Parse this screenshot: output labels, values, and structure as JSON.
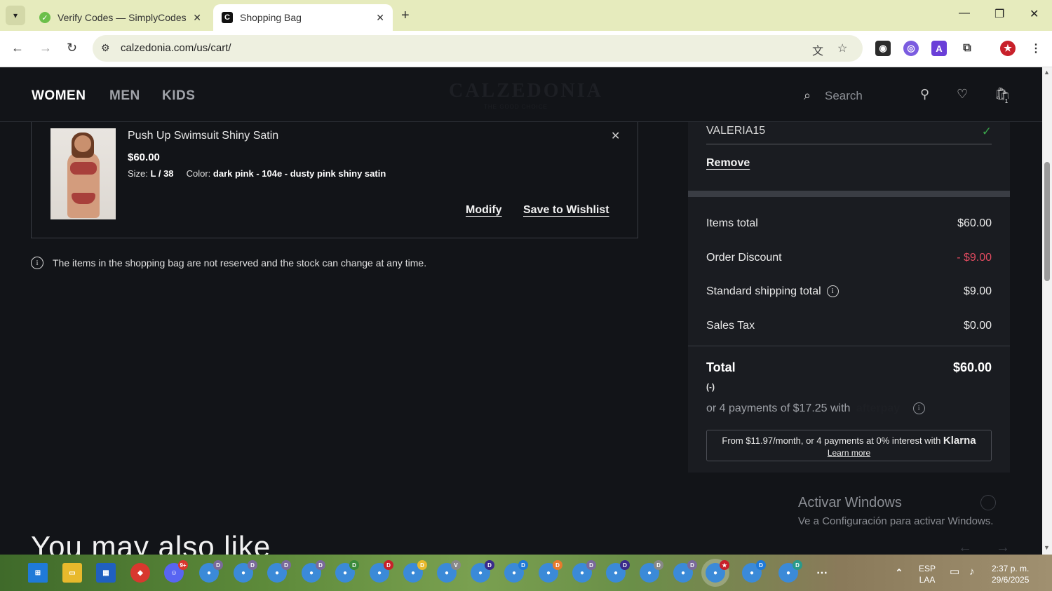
{
  "browser": {
    "tabs": [
      {
        "title": "Verify Codes — SimplyCodes",
        "icon": "simplycodes-icon"
      },
      {
        "title": "Shopping Bag",
        "icon": "calzedonia-icon"
      }
    ],
    "url": "calzedonia.com/us/cart/"
  },
  "header": {
    "nav": [
      "WOMEN",
      "MEN",
      "KIDS"
    ],
    "logo": "CALZEDONIA",
    "logo_sub": "THE GOOD CHOICE",
    "search_placeholder": "Search",
    "bag_count": "1"
  },
  "cart_item": {
    "name": "Push Up Swimsuit Shiny Satin",
    "price": "$60.00",
    "size_label": "Size:",
    "size_value": "L / 38",
    "color_label": "Color:",
    "color_value": "dark pink - 104e - dusty pink shiny satin",
    "modify": "Modify",
    "wishlist": "Save to Wishlist"
  },
  "notice": "The items in the shopping bag are not reserved and the stock can change at any time.",
  "summary": {
    "coupon_code": "VALERIA15",
    "remove": "Remove",
    "rows": [
      {
        "label": "Items total",
        "value": "$60.00"
      },
      {
        "label": "Order Discount",
        "value": "- $9.00"
      },
      {
        "label": "Standard shipping total",
        "value": "$9.00"
      },
      {
        "label": "Sales Tax",
        "value": "$0.00"
      }
    ],
    "total_label": "Total",
    "total_value": "$60.00",
    "total_sub": "(-)",
    "afterpay_text": "or 4 payments of $17.25 with",
    "afterpay_brand": "afterpay",
    "klarna_text": "From $11.97/month, or 4 payments at 0% interest with",
    "klarna_brand": "Klarna",
    "klarna_link": "Learn more"
  },
  "recommend_title": "You may also like",
  "windows_watermark": {
    "title": "Activar Windows",
    "subtitle": "Ve a Configuración para activar Windows."
  },
  "tray": {
    "lang1": "ESP",
    "lang2": "LAA",
    "time": "2:37 p. m.",
    "date": "29/6/2025"
  },
  "colors": {
    "discount": "#e04a5f",
    "check": "#3aa44a",
    "page_bg": "#121418"
  }
}
